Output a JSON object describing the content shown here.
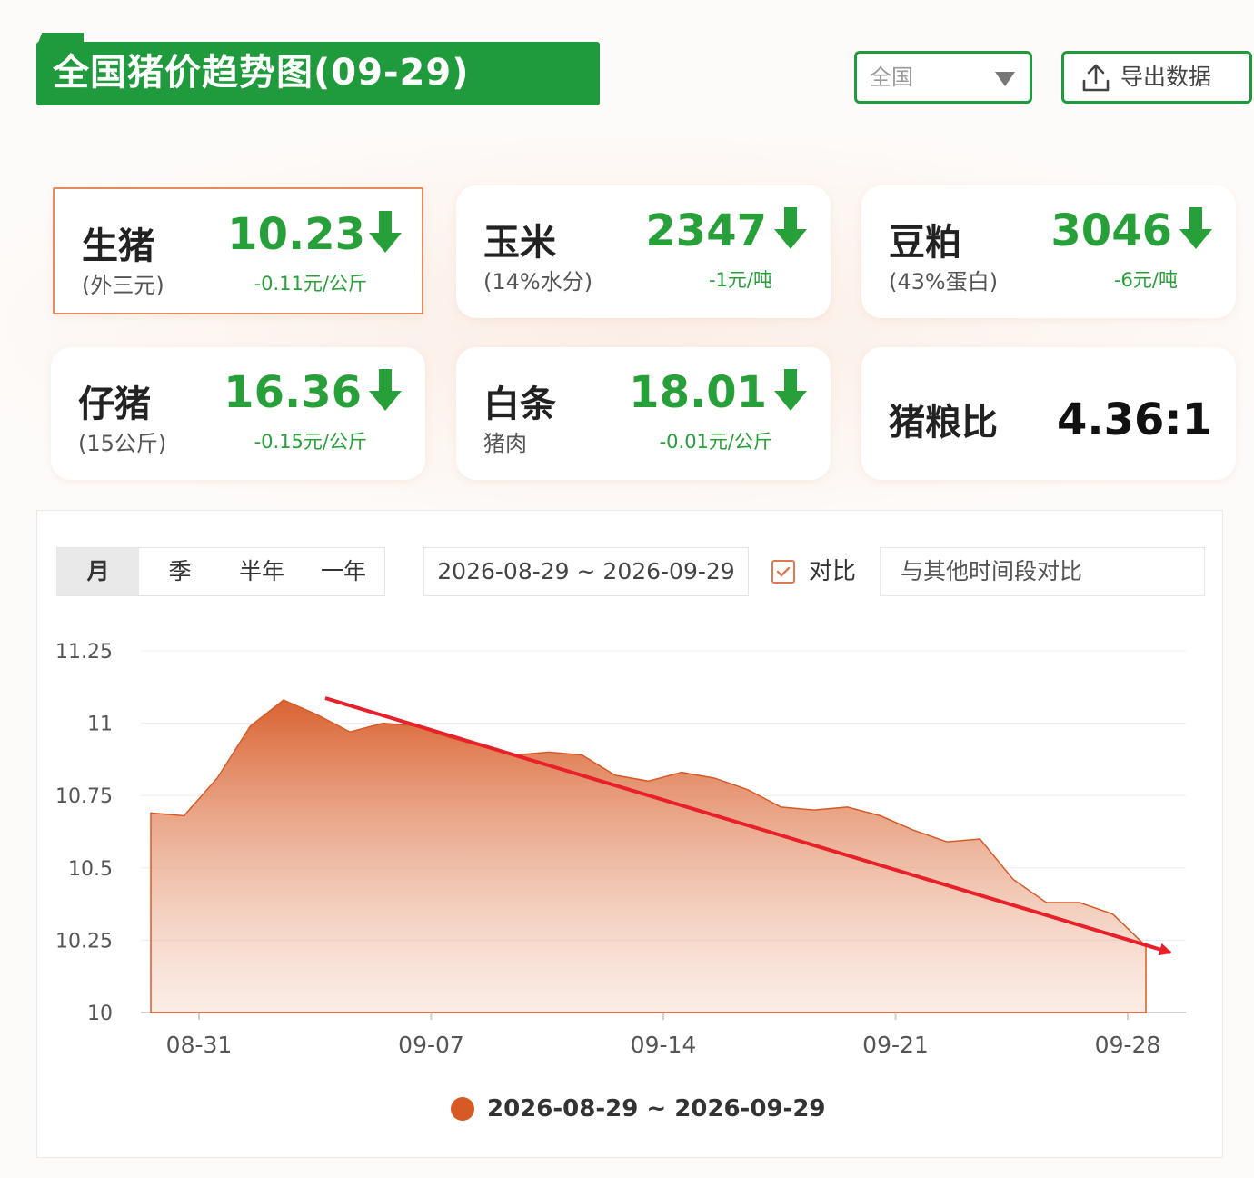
{
  "header": {
    "title": "全国猪价趋势图(09-29)",
    "region_select": "全国",
    "export_label": "导出数据"
  },
  "cards": {
    "hog": {
      "name": "生猪",
      "sub": "(外三元)",
      "value": "10.23",
      "change": "-0.11元/公斤"
    },
    "corn": {
      "name": "玉米",
      "sub": "(14%水分)",
      "value": "2347",
      "change": "-1元/吨"
    },
    "soymeal": {
      "name": "豆粕",
      "sub": "(43%蛋白)",
      "value": "3046",
      "change": "-6元/吨"
    },
    "piglet": {
      "name": "仔猪",
      "sub": "(15公斤)",
      "value": "16.36",
      "change": "-0.15元/公斤"
    },
    "pork": {
      "name": "白条",
      "sub": "猪肉",
      "value": "18.01",
      "change": "-0.01元/公斤"
    },
    "ratio": {
      "name": "猪粮比",
      "value": "4.36:1"
    }
  },
  "colors": {
    "brand_green": "#1f9a3c",
    "down_green": "#27a03a",
    "area_orange": "#d75a26",
    "trend_red": "#e8202a"
  },
  "icons": {
    "export": "upload-icon",
    "select": "caret-down-icon",
    "trend": "down-arrow-icon",
    "checkbox": "checkbox-checked-icon"
  },
  "controls": {
    "tabs": [
      "月",
      "季",
      "半年",
      "一年"
    ],
    "active_tab": "月",
    "date_range": "2026-08-29 ~ 2026-09-29",
    "compare_label": "对比",
    "compare_checked": true,
    "compare_placeholder": "与其他时间段对比"
  },
  "chart_data": {
    "type": "area",
    "x": [
      "08-29",
      "08-30",
      "08-31",
      "09-01",
      "09-02",
      "09-03",
      "09-04",
      "09-05",
      "09-06",
      "09-07",
      "09-08",
      "09-09",
      "09-10",
      "09-11",
      "09-12",
      "09-13",
      "09-14",
      "09-15",
      "09-16",
      "09-17",
      "09-18",
      "09-19",
      "09-20",
      "09-21",
      "09-22",
      "09-23",
      "09-24",
      "09-25",
      "09-26",
      "09-27",
      "09-28",
      "09-29"
    ],
    "series": [
      {
        "name": "2026-08-29 ~ 2026-09-29",
        "values": [
          10.69,
          10.68,
          10.81,
          10.99,
          11.08,
          11.03,
          10.97,
          11.0,
          10.99,
          10.95,
          10.92,
          10.89,
          10.9,
          10.89,
          10.82,
          10.8,
          10.83,
          10.81,
          10.77,
          10.71,
          10.7,
          10.71,
          10.68,
          10.63,
          10.59,
          10.6,
          10.46,
          10.38,
          10.38,
          10.34,
          10.23
        ]
      }
    ],
    "x_ticks": [
      "08-31",
      "09-07",
      "09-14",
      "09-21",
      "09-28"
    ],
    "y_ticks": [
      10,
      10.25,
      10.5,
      10.75,
      11,
      11.25
    ],
    "ylim": [
      10,
      11.25
    ],
    "grid": true,
    "legend": "bottom-center",
    "annotation": "red downward trend arrow"
  }
}
